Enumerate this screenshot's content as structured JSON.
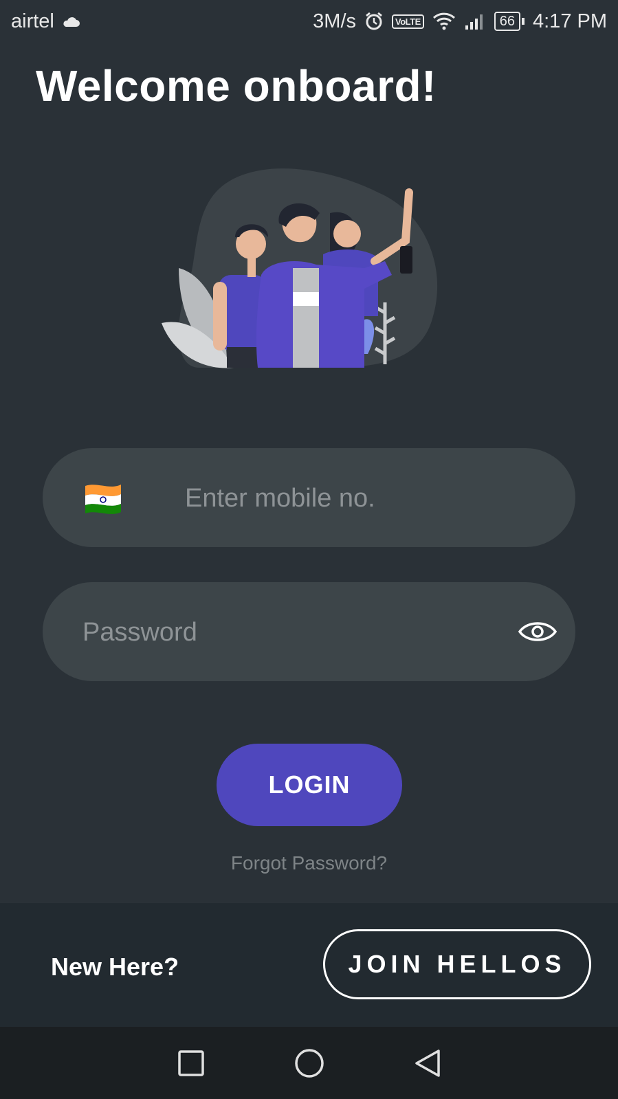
{
  "status_bar": {
    "carrier": "airtel",
    "network_speed": "3M/s",
    "volte": "VoLTE",
    "battery": "66",
    "time": "4:17 PM"
  },
  "title": "Welcome onboard!",
  "mobile": {
    "placeholder": "Enter mobile no.",
    "value": ""
  },
  "password": {
    "placeholder": "Password",
    "value": ""
  },
  "login_label": "LOGIN",
  "forgot_label": "Forgot Password?",
  "footer": {
    "prompt": "New Here?",
    "join_label": "JOIN HELLOS"
  },
  "colors": {
    "background": "#2a3137",
    "field": "#3d4549",
    "accent": "#4f47bd",
    "footer": "#222a30",
    "nav": "#1b1f22"
  },
  "icons": {
    "flag": "india-flag-icon",
    "eye": "eye-icon",
    "nav": [
      "square-recents-icon",
      "circle-home-icon",
      "triangle-back-icon"
    ]
  }
}
